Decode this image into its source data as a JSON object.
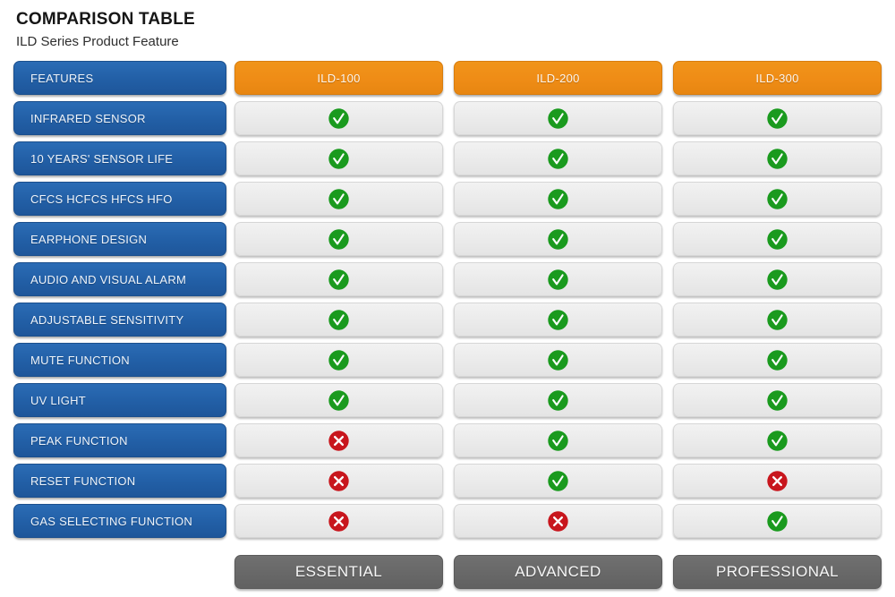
{
  "header": {
    "main_title": "COMPARISON TABLE",
    "sub_title": "ILD Series Product Feature"
  },
  "columns": {
    "feature_header": "FEATURES",
    "products": [
      "ILD-100",
      "ILD-200",
      "ILD-300"
    ]
  },
  "rows": [
    {
      "feature": "INFRARED SENSOR",
      "values": [
        "yes",
        "yes",
        "yes"
      ]
    },
    {
      "feature": "10 YEARS' SENSOR LIFE",
      "values": [
        "yes",
        "yes",
        "yes"
      ]
    },
    {
      "feature": "CFCS HCFCS HFCS HFO",
      "values": [
        "yes",
        "yes",
        "yes"
      ]
    },
    {
      "feature": "EARPHONE DESIGN",
      "values": [
        "yes",
        "yes",
        "yes"
      ]
    },
    {
      "feature": "AUDIO AND VISUAL ALARM",
      "values": [
        "yes",
        "yes",
        "yes"
      ]
    },
    {
      "feature": "ADJUSTABLE SENSITIVITY",
      "values": [
        "yes",
        "yes",
        "yes"
      ]
    },
    {
      "feature": "MUTE FUNCTION",
      "values": [
        "yes",
        "yes",
        "yes"
      ]
    },
    {
      "feature": "UV LIGHT",
      "values": [
        "yes",
        "yes",
        "yes"
      ]
    },
    {
      "feature": "PEAK FUNCTION",
      "values": [
        "no",
        "yes",
        "yes"
      ]
    },
    {
      "feature": "RESET FUNCTION",
      "values": [
        "no",
        "yes",
        "no"
      ]
    },
    {
      "feature": "GAS SELECTING FUNCTION",
      "values": [
        "no",
        "no",
        "yes"
      ]
    }
  ],
  "footer": {
    "tiers": [
      "ESSENTIAL",
      "ADVANCED",
      "PROFESSIONAL"
    ]
  },
  "icons": {
    "yes": {
      "name": "check-circle-icon",
      "glyph": "check",
      "color": "#1a9a1e"
    },
    "no": {
      "name": "cross-circle-icon",
      "glyph": "cross",
      "color": "#c8161d"
    }
  },
  "colors": {
    "feature_pill": "#225fa6",
    "product_header": "#ef8c16",
    "cell": "#ebebeb",
    "footer_pill": "#686868",
    "check_green": "#1a9a1e",
    "cross_red": "#c8161d",
    "page_background": "#ffffff"
  }
}
